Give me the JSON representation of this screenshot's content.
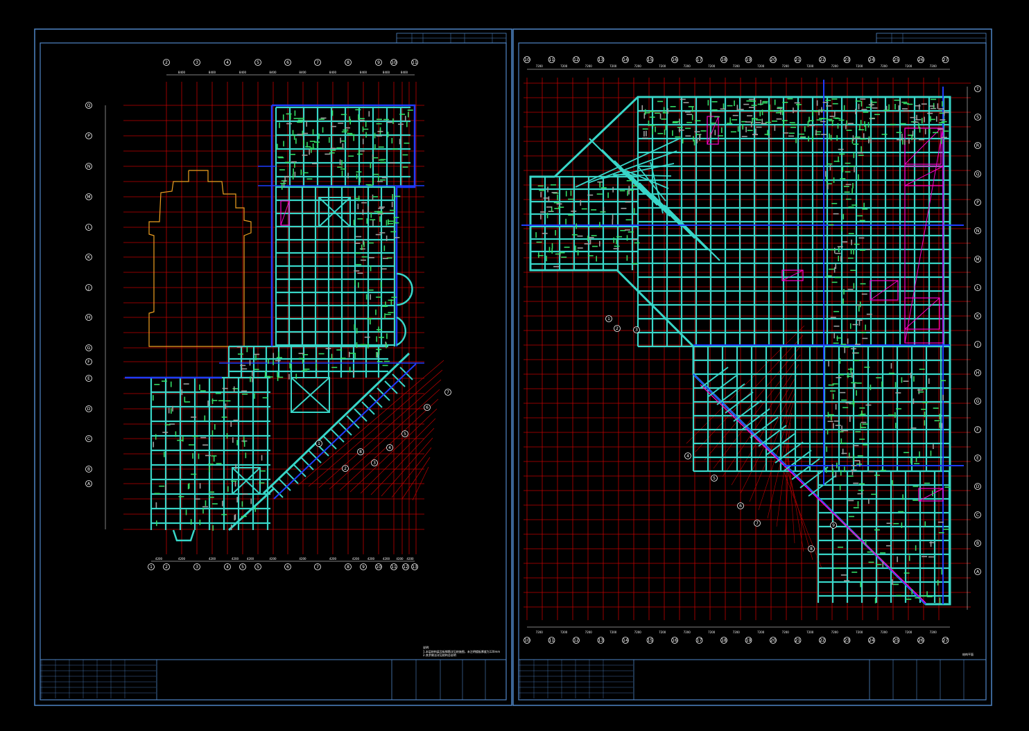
{
  "app": {
    "background_color": "#000000"
  },
  "colors": {
    "frame": "#4f86c6",
    "axis_grid": "#c00000",
    "beam": "#38d6c8",
    "wall": "#1f3cff",
    "rebar": "#33dd66",
    "void": "#ff00cc",
    "outline": "#f0a020",
    "text": "#ffffff"
  },
  "sheets": [
    {
      "name": "sheet-left",
      "top_axes": [
        "2",
        "3",
        "4",
        "5",
        "6",
        "7",
        "8",
        "9",
        "10",
        "11"
      ],
      "bottom_axes": [
        "1",
        "2",
        "3",
        "4",
        "5",
        "5",
        "6",
        "7",
        "8",
        "9",
        "10",
        "11",
        "12",
        "13"
      ],
      "left_axes": [
        "Q",
        "P",
        "N",
        "M",
        "L",
        "K",
        "J",
        "H",
        "G",
        "F",
        "E",
        "D",
        "C",
        "B",
        "A"
      ],
      "note_title": "说明:",
      "note_lines": [
        "1.本层结构梁及板钢筋详见结施图，未注明楼板厚度为120mm",
        "2.其余做法详见结构总说明"
      ]
    },
    {
      "name": "sheet-right",
      "top_axes": [
        "10",
        "11",
        "12",
        "13",
        "14",
        "15",
        "16",
        "17",
        "18",
        "19",
        "20",
        "21",
        "22",
        "23",
        "24",
        "25",
        "26",
        "27"
      ],
      "bottom_axes": [
        "10",
        "11",
        "12",
        "13",
        "14",
        "15",
        "16",
        "17",
        "18",
        "19",
        "20",
        "21",
        "22",
        "23",
        "24",
        "25",
        "26",
        "27"
      ],
      "right_axes": [
        "T",
        "S",
        "R",
        "Q",
        "P",
        "N",
        "M",
        "L",
        "K",
        "J",
        "H",
        "G",
        "F",
        "E",
        "D",
        "C",
        "B",
        "A"
      ],
      "sheet_label": "结构平面"
    }
  ]
}
